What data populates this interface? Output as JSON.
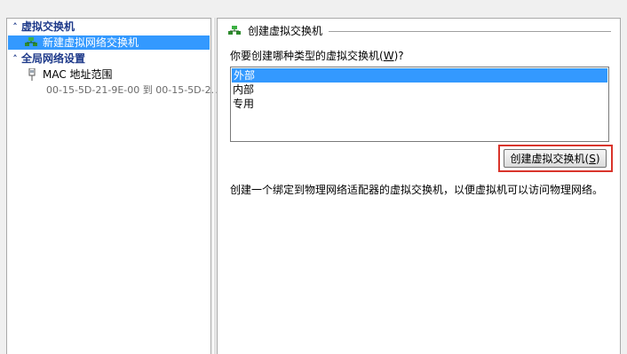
{
  "left_pane": {
    "sections": [
      {
        "title": "虚拟交换机",
        "items": [
          {
            "label": "新建虚拟网络交换机",
            "selected": true,
            "icon": "switch-icon"
          }
        ]
      },
      {
        "title": "全局网络设置",
        "items": [
          {
            "label": "MAC 地址范围",
            "sublabel": "00-15-5D-21-9E-00 到 00-15-5D-2...",
            "icon": "network-adapter-icon"
          }
        ]
      }
    ]
  },
  "right_pane": {
    "group_title": "创建虚拟交换机",
    "question_prefix": "你要创建哪种类型的虚拟交换机(",
    "question_hotkey": "W",
    "question_suffix": ")?",
    "switch_types": [
      "外部",
      "内部",
      "专用"
    ],
    "selected_type": "外部",
    "create_button_prefix": "创建虚拟交换机(",
    "create_button_hotkey": "S",
    "create_button_suffix": ")",
    "description": "创建一个绑定到物理网络适配器的虚拟交换机，以便虚拟机可以访问物理网络。"
  },
  "colors": {
    "selection": "#3399ff",
    "section_header": "#1e3a8a",
    "highlight_border": "#d9342b"
  }
}
